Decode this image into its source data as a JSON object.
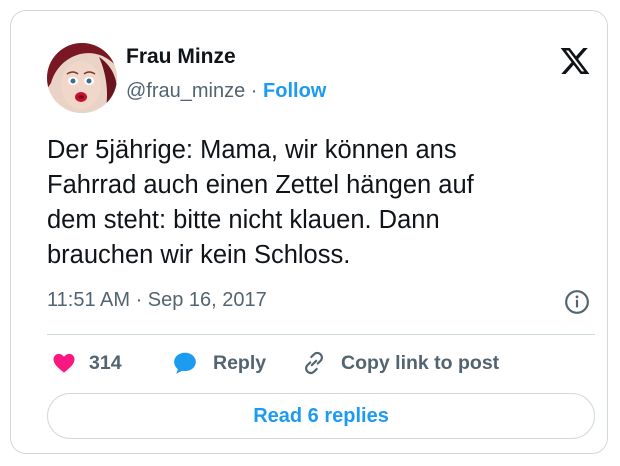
{
  "author": {
    "display_name": "Frau Minze",
    "handle": "@frau_minze",
    "separator": " · ",
    "follow_label": "Follow"
  },
  "tweet": {
    "text": "Der 5jährige: Mama, wir können ans\nFahrrad auch einen Zettel hängen auf\ndem steht: bitte nicht klauen. Dann\nbrauchen wir kein Schloss.",
    "timestamp": "11:51 AM · Sep 16, 2017"
  },
  "actions": {
    "likes": "314",
    "reply_label": "Reply",
    "copy_label": "Copy link to post"
  },
  "read_replies_label": "Read 6 replies",
  "icons": {
    "brand": "x-logo-icon",
    "info": "info-icon",
    "like": "heart-icon",
    "reply": "speech-bubble-icon",
    "copy": "link-icon"
  },
  "colors": {
    "accent": "#1d9bf0",
    "heart": "#f91880",
    "muted_text": "#536471",
    "border": "#cfd9de"
  }
}
